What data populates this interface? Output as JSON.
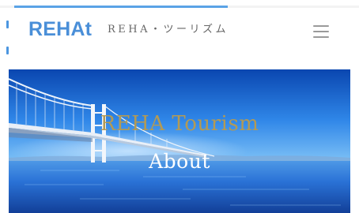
{
  "progress": {
    "value_fraction": 0.62,
    "color": "#5aa3e6"
  },
  "header": {
    "logo": "REHAt",
    "tagline": "REHA・ツーリズム",
    "logo_color": "#4a8fd8",
    "menu_icon": "hamburger-menu-icon"
  },
  "hero": {
    "title": "REHA Tourism",
    "subtitle": "About",
    "title_color": "#b39a54",
    "subtitle_color": "#ffffff",
    "image_subject": "bridge-over-sea-image"
  }
}
